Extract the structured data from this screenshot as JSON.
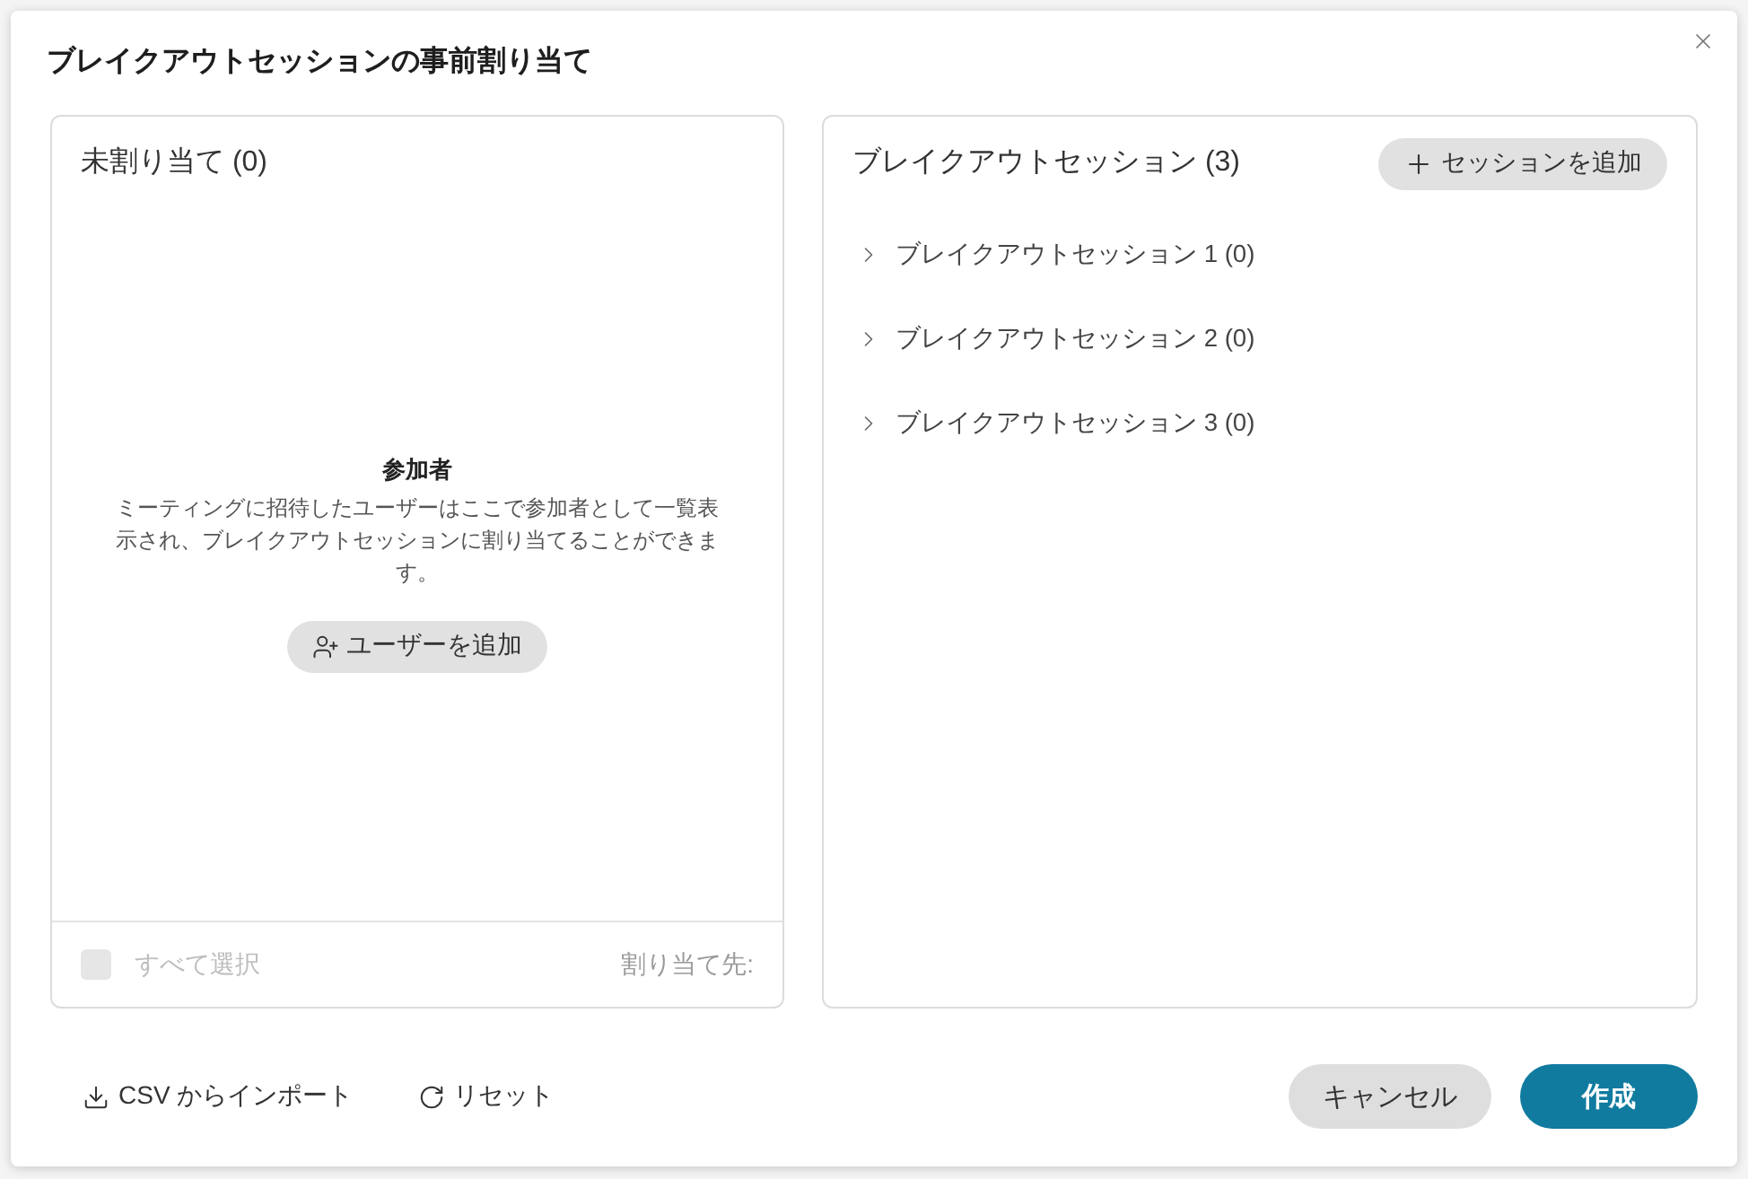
{
  "dialog": {
    "title": "ブレイクアウトセッションの事前割り当て"
  },
  "unassigned_panel": {
    "title": "未割り当て (0)",
    "empty_state": {
      "heading": "参加者",
      "description": "ミーティングに招待したユーザーはここで参加者として一覧表示され、ブレイクアウトセッションに割り当てることができます。",
      "add_button": "ユーザーを追加"
    },
    "select_all": {
      "label": "すべて選択",
      "checked": false,
      "disabled": true
    },
    "assign_to_label": "割り当て先:"
  },
  "sessions_panel": {
    "title": "ブレイクアウトセッション (3)",
    "add_button": "セッションを追加",
    "sessions": [
      {
        "label": "ブレイクアウトセッション 1 (0)",
        "expanded": false
      },
      {
        "label": "ブレイクアウトセッション 2 (0)",
        "expanded": false
      },
      {
        "label": "ブレイクアウトセッション 3 (0)",
        "expanded": false
      }
    ]
  },
  "footer": {
    "links": [
      {
        "kind": "import",
        "label": "CSV からインポート"
      },
      {
        "kind": "reset",
        "label": "リセット"
      }
    ],
    "buttons": [
      {
        "kind": "secondary",
        "label": "キャンセル"
      },
      {
        "kind": "primary",
        "label": "作成"
      }
    ]
  }
}
